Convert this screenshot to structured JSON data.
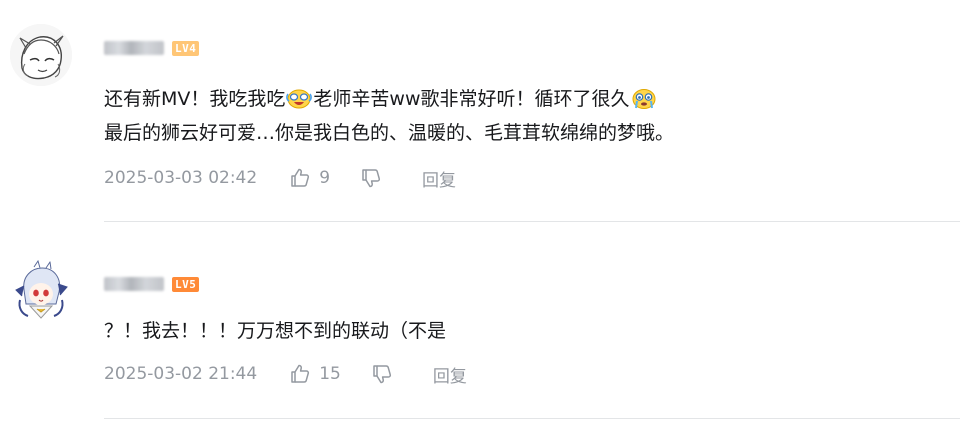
{
  "comments": [
    {
      "level": "LV4",
      "text_line1_part1": "还有新MV！我吃我吃",
      "text_line1_part2": "老师辛苦ww歌非常好听！循环了很久",
      "text_line2": "最后的狮云好可爱…你是我白色的、温暖的、毛茸茸软绵绵的梦哦。",
      "emotes": [
        "laughing-tears-emote",
        "crying-emote"
      ],
      "timestamp": "2025-03-03 02:42",
      "likes": "9",
      "reply_label": "回复"
    },
    {
      "level": "LV5",
      "text_line1": "？！我去！！！万万想不到的联动（不是",
      "timestamp": "2025-03-02 21:44",
      "likes": "15",
      "reply_label": "回复"
    }
  ],
  "colors": {
    "text": "#18191c",
    "meta": "#9499a0",
    "divider": "#e3e5e7",
    "lv4": "#ffc676",
    "lv5": "#ff8a37"
  }
}
